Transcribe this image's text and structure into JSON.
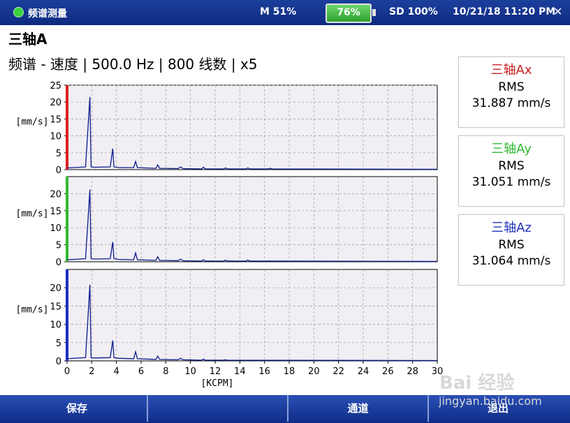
{
  "statusbar": {
    "app_name": "频谱测量",
    "memory": "M 51%",
    "battery": "76%",
    "sd": "SD 100%",
    "datetime": "10/21/18 11:20 PM"
  },
  "heading": "三轴A",
  "subheading": "频谱 - 速度 | 500.0 Hz | 800 线数 | x5",
  "rms_panels": [
    {
      "prefix": "三轴",
      "axis": "Ax",
      "color": "#cc2020",
      "label": "RMS",
      "value": "31.887 mm/s"
    },
    {
      "prefix": "三轴",
      "axis": "Ay",
      "color": "#33bb33",
      "label": "RMS",
      "value": "31.051 mm/s"
    },
    {
      "prefix": "三轴",
      "axis": "Az",
      "color": "#2233bb",
      "label": "RMS",
      "value": "31.064 mm/s"
    }
  ],
  "softkeys": [
    "保存",
    "",
    "通道",
    "退出"
  ],
  "watermark": {
    "brand": "Bai 经验",
    "url": "jingyan.baidu.com"
  },
  "chart_data": [
    {
      "type": "line",
      "ylabel": "[mm/s]",
      "axis_color": "#dd2020",
      "yticks": [
        0,
        5,
        10,
        15,
        20,
        25
      ],
      "ylim": [
        0,
        25
      ],
      "x": [
        0,
        1.5,
        1.85,
        1.95,
        2.2,
        3.5,
        3.7,
        3.8,
        4.2,
        5.4,
        5.55,
        5.7,
        7.2,
        7.35,
        7.5,
        9.0,
        9.2,
        9.4,
        10.9,
        11.05,
        11.2,
        12.7,
        12.85,
        13.0,
        14.5,
        14.65,
        14.8,
        16.3,
        16.45,
        16.6,
        30
      ],
      "values": [
        0.5,
        0.8,
        21.5,
        0.8,
        0.7,
        0.8,
        6.2,
        0.8,
        0.6,
        0.6,
        2.4,
        0.6,
        0.4,
        1.4,
        0.4,
        0.3,
        0.8,
        0.3,
        0.2,
        0.7,
        0.2,
        0.2,
        0.5,
        0.2,
        0.2,
        0.5,
        0.2,
        0.2,
        0.4,
        0.2,
        0.1
      ]
    },
    {
      "type": "line",
      "ylabel": "[mm/s]",
      "axis_color": "#33bb33",
      "yticks": [
        0,
        5,
        10,
        15,
        20
      ],
      "ylim": [
        0,
        25
      ],
      "x": [
        0,
        1.5,
        1.85,
        1.95,
        2.2,
        3.5,
        3.7,
        3.8,
        4.2,
        5.4,
        5.55,
        5.7,
        7.2,
        7.35,
        7.5,
        9.0,
        9.2,
        9.4,
        10.9,
        11.05,
        11.2,
        12.7,
        12.85,
        13.0,
        14.5,
        14.65,
        14.8,
        30
      ],
      "values": [
        0.6,
        0.9,
        21.2,
        0.9,
        0.8,
        0.9,
        5.8,
        0.9,
        0.7,
        0.6,
        2.6,
        0.6,
        0.4,
        1.5,
        0.4,
        0.3,
        0.8,
        0.3,
        0.2,
        0.6,
        0.2,
        0.2,
        0.5,
        0.2,
        0.2,
        0.5,
        0.2,
        0.1
      ]
    },
    {
      "type": "line",
      "ylabel": "[mm/s]",
      "axis_color": "#1b2fbf",
      "yticks": [
        0,
        5,
        10,
        15,
        20
      ],
      "ylim": [
        0,
        25
      ],
      "xlabel": "[KCPM]",
      "xticks": [
        0,
        2,
        4,
        6,
        8,
        10,
        12,
        14,
        16,
        18,
        20,
        22,
        24,
        26,
        28,
        30
      ],
      "xlim": [
        0,
        30
      ],
      "x": [
        0,
        1.5,
        1.85,
        1.95,
        2.2,
        3.5,
        3.7,
        3.8,
        4.2,
        5.4,
        5.55,
        5.7,
        7.2,
        7.35,
        7.5,
        9.0,
        9.2,
        9.4,
        10.9,
        11.05,
        11.2,
        12.7,
        12.85,
        13.0,
        30
      ],
      "values": [
        0.6,
        0.9,
        20.8,
        0.9,
        0.8,
        0.9,
        5.6,
        0.9,
        0.7,
        0.6,
        2.5,
        0.6,
        0.4,
        1.3,
        0.4,
        0.3,
        0.7,
        0.3,
        0.2,
        0.5,
        0.2,
        0.2,
        0.3,
        0.2,
        0.1
      ]
    }
  ]
}
